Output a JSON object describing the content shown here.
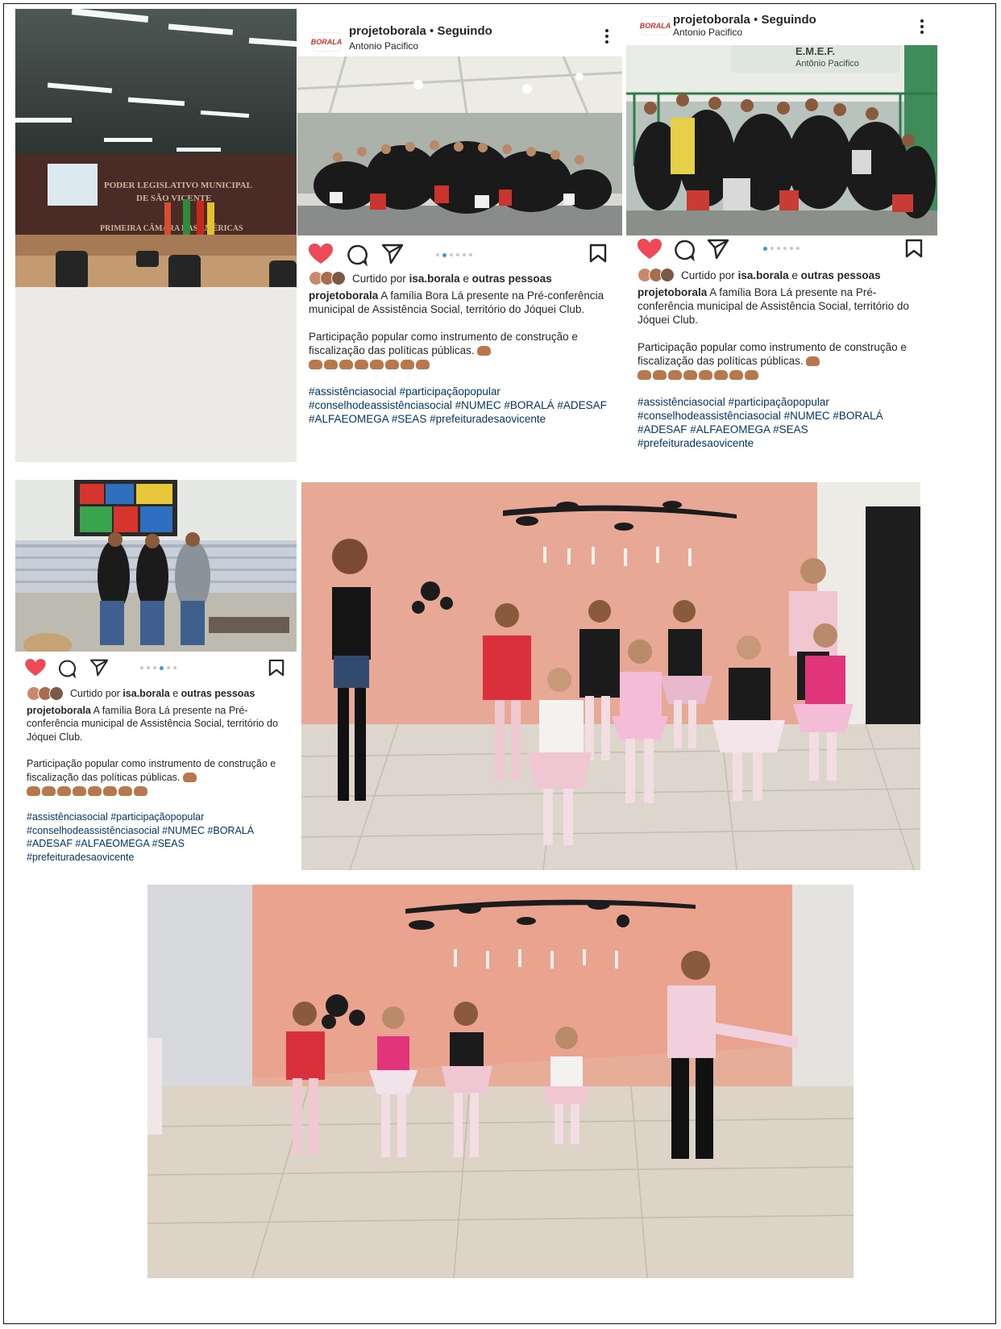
{
  "post": {
    "username": "projetoborala",
    "follow_status": "Seguindo",
    "location": "Antonio Pacifico",
    "avatar_text": "BORALA",
    "liked_prefix": "Curtido por",
    "liked_user": "isa.borala",
    "liked_joiner": "e",
    "liked_others": "outras pessoas",
    "caption_author": "projetoborala",
    "caption_line1": "A família Bora Lá presente na Pré-conferência municipal de Assistência Social, território do Jóquei Club.",
    "caption_line2": "Participação popular como instrumento de construção e fiscalização das políticas públicas.",
    "hashtags": "#assistênciasocial #participaçãopopular #conselhodeassistênciasocial #NUMEC #BORALÁ #ADESAF #ALFAEOMEGA #SEAS #prefeituradesaovicente"
  },
  "photos": {
    "chamber": {
      "sign_line1": "PODER LEGISLATIVO MUNICIPAL",
      "sign_line2": "DE SÃO VICENTE",
      "sign_line3": "PRIMEIRA CÂMARA DAS AMÉRICAS"
    },
    "school": {
      "sign_line1": "E.M.E.F.",
      "sign_line2": "Antônio Pacifico"
    }
  },
  "colors": {
    "like_red": "#ed4956",
    "hashtag_blue": "#00376b",
    "dot_active": "#3897f0",
    "wall_pink": "#e8a896"
  }
}
